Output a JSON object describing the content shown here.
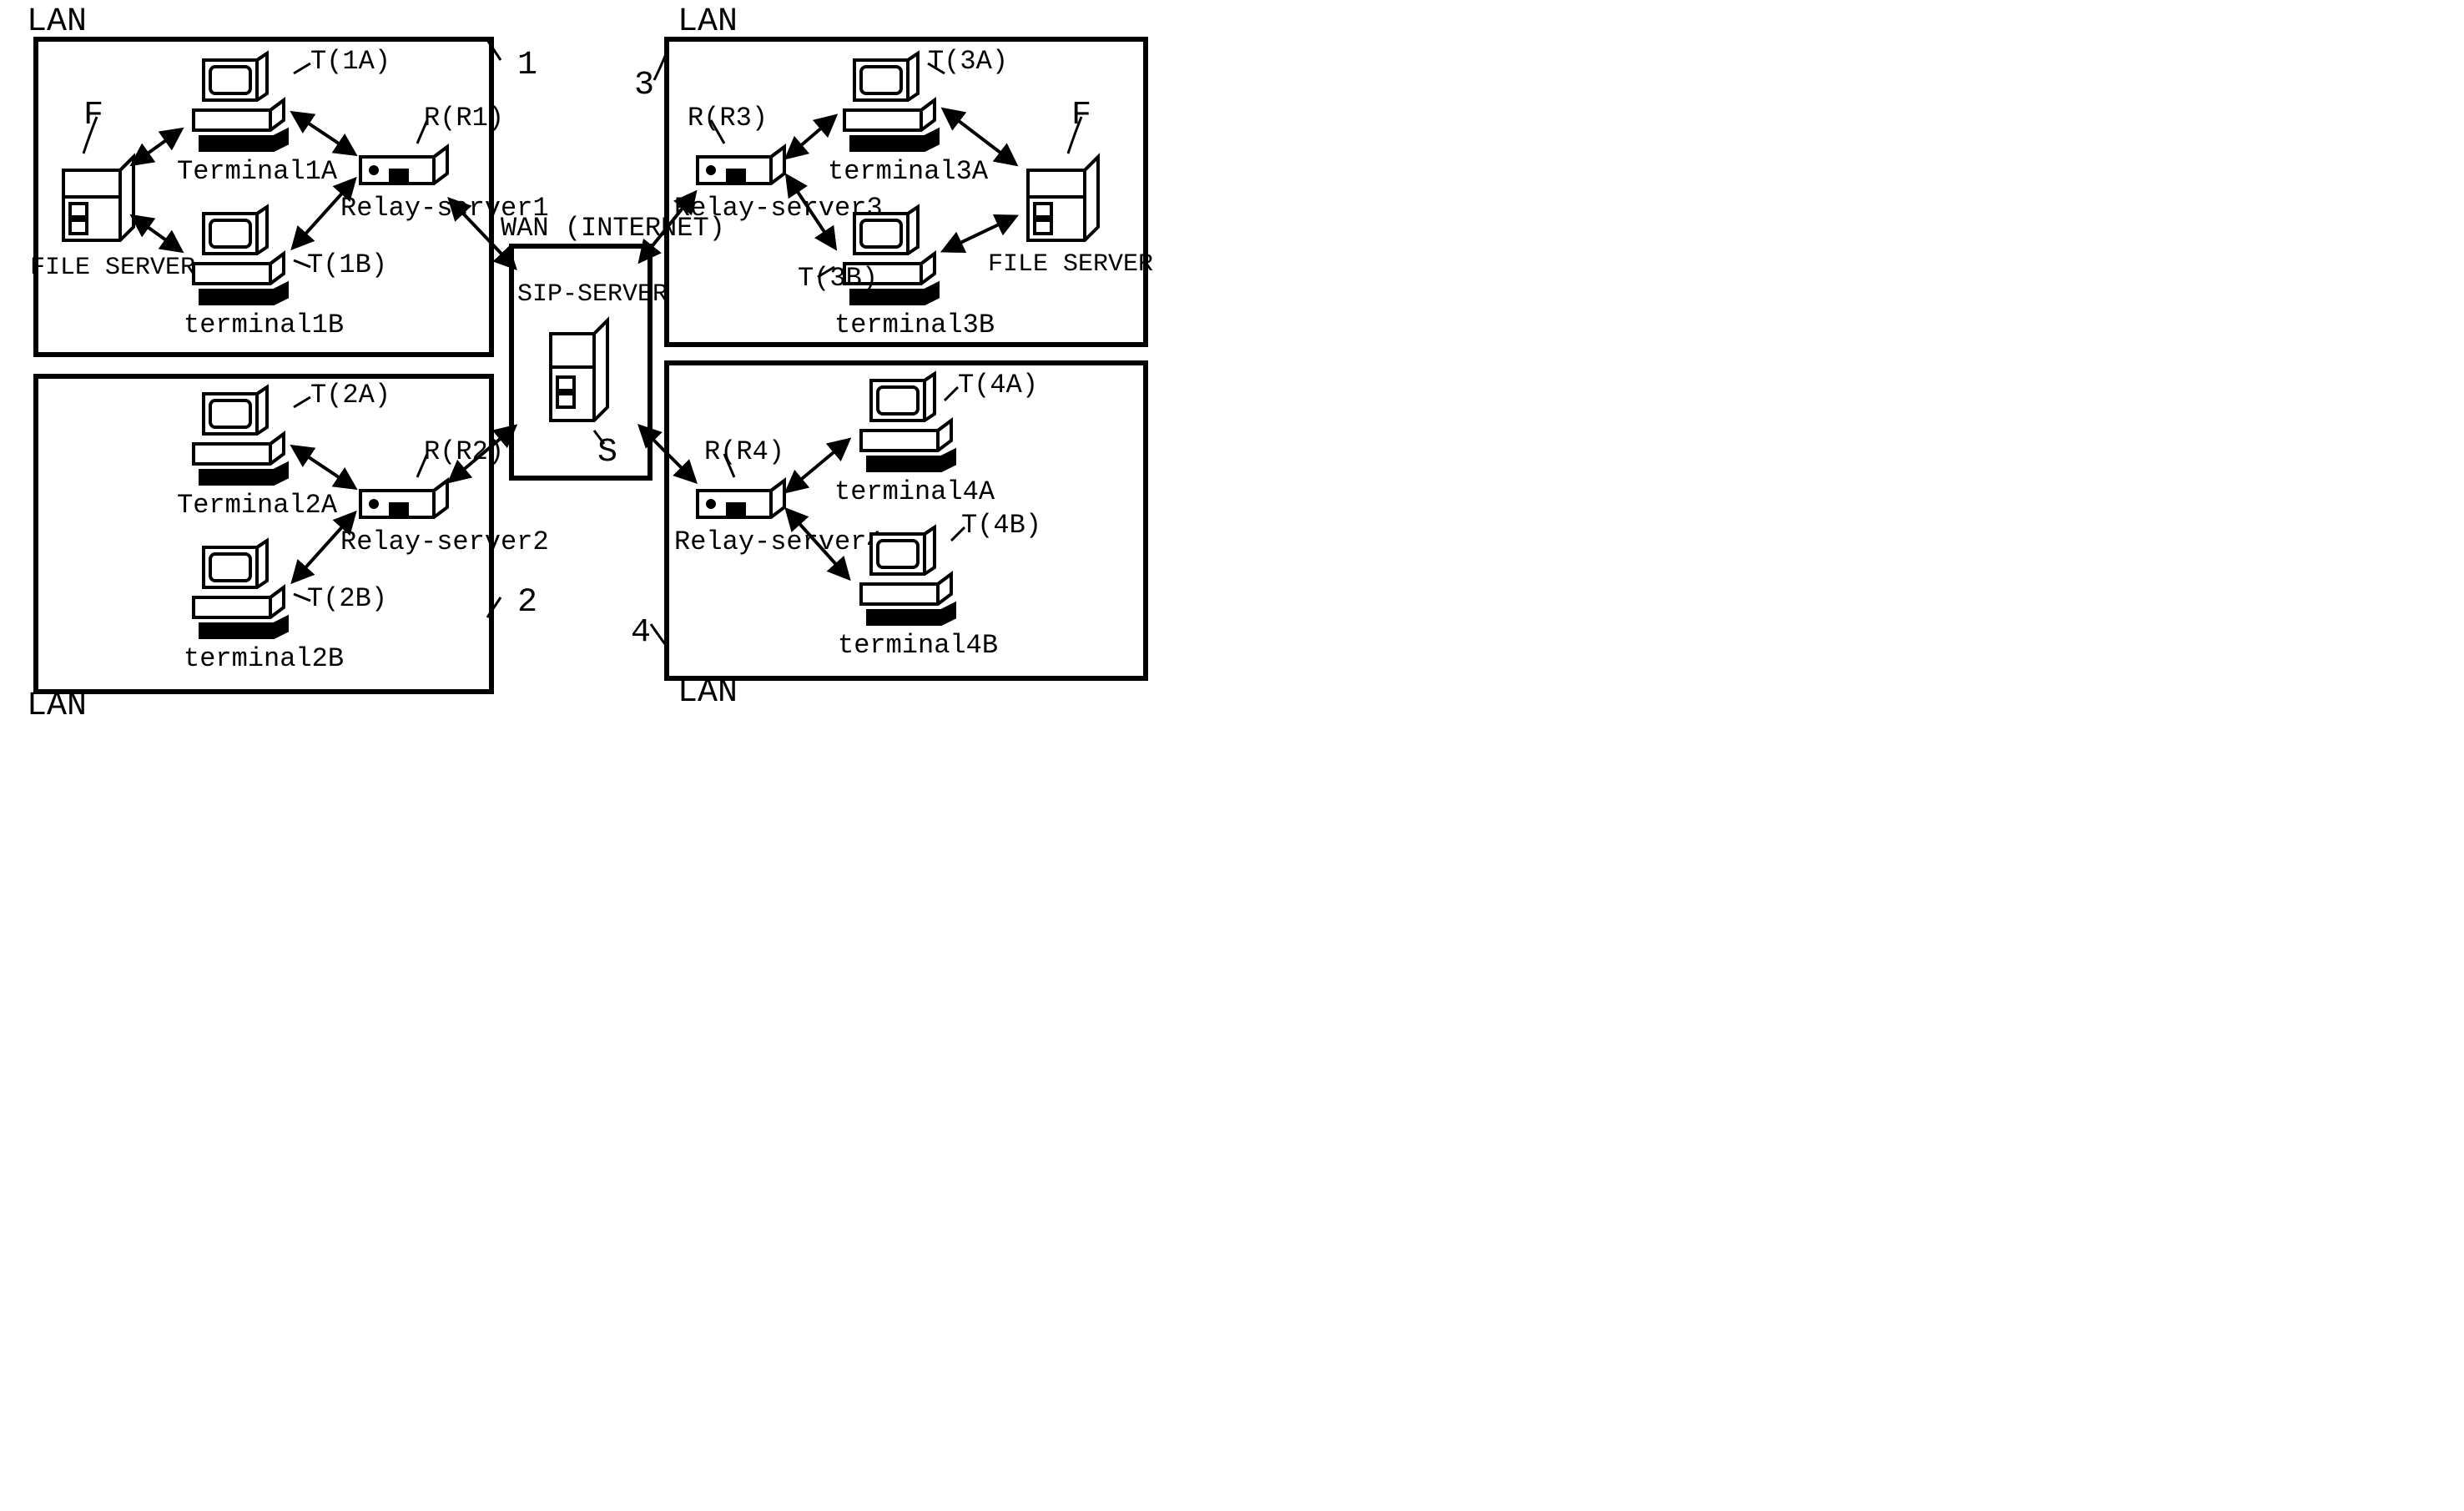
{
  "wan_title": "WAN (INTERNET)",
  "sip_label": "SIP-SERVER",
  "sip_id": "S",
  "lan_label": "LAN",
  "file_server_label": "FILE SERVER",
  "lans": {
    "lan1": {
      "id": "1",
      "F": "F",
      "relay": {
        "label": "Relay-server1",
        "id": "R(R1)"
      },
      "tA": {
        "label": "Terminal1A",
        "id": "T(1A)"
      },
      "tB": {
        "label": "terminal1B",
        "id": "T(1B)"
      }
    },
    "lan2": {
      "id": "2",
      "relay": {
        "label": "Relay-server2",
        "id": "R(R2)"
      },
      "tA": {
        "label": "Terminal2A",
        "id": "T(2A)"
      },
      "tB": {
        "label": "terminal2B",
        "id": "T(2B)"
      }
    },
    "lan3": {
      "id": "3",
      "F": "F",
      "relay": {
        "label": "Relay-server3",
        "id": "R(R3)"
      },
      "tA": {
        "label": "terminal3A",
        "id": "T(3A)"
      },
      "tB": {
        "label": "terminal3B",
        "id": "T(3B)"
      }
    },
    "lan4": {
      "id": "4",
      "relay": {
        "label": "Relay-server4",
        "id": "R(R4)"
      },
      "tA": {
        "label": "terminal4A",
        "id": "T(4A)"
      },
      "tB": {
        "label": "terminal4B",
        "id": "T(4B)"
      }
    }
  }
}
